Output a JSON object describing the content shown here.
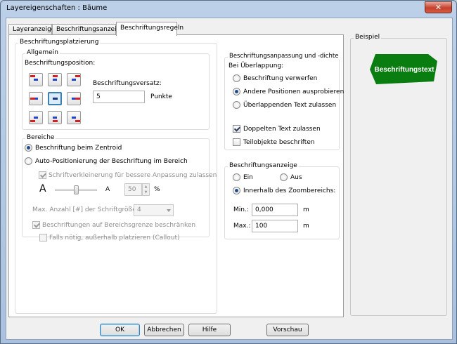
{
  "window": {
    "title": "Layereigenschaften : Bäume",
    "close_glyph": "✕"
  },
  "tabs": [
    "Layeranzeige",
    "Beschriftungsanzeige",
    "Beschriftungsregeln"
  ],
  "placement": {
    "title": "Beschriftungsplatzierung",
    "general": {
      "title": "Allgemein",
      "position_label": "Beschriftungsposition:",
      "offset_label": "Beschriftungsversatz:",
      "offset_value": "5",
      "offset_unit": "Punkte"
    },
    "areas": {
      "title": "Bereiche",
      "centroid": "Beschriftung beim Zentroid",
      "auto_position": "Auto-Positionierung der Beschriftung im Bereich",
      "font_reduce": "Schriftverkleinerung für bessere Anpassung zulassen",
      "big_a": "A",
      "small_a": "A",
      "percent_value": "50",
      "percent_unit": "%",
      "max_sizes_label": "Max. Anzahl [#] der Schriftgrößen:",
      "max_sizes_value": "4",
      "restrict": "Beschriftungen auf Bereichsgrenze beschränken",
      "callout": "Falls nötig, außerhalb platzieren (Callout)"
    }
  },
  "overlap": {
    "title": "Beschriftungsanpassung und -dichte",
    "on_overlap": "Bei Überlappung:",
    "discard": "Beschriftung verwerfen",
    "try_other": "Andere Positionen ausprobieren",
    "allow_overlap": "Überlappenden Text zulassen",
    "allow_duplicate": "Doppelten Text zulassen",
    "label_parts": "Teilobjekte beschriften"
  },
  "display": {
    "title": "Beschriftungsanzeige",
    "on": "Ein",
    "off": "Aus",
    "in_zoom": "Innerhalb des Zoombereichs:",
    "min_label": "Min.:",
    "min_value": "0,000",
    "max_label": "Max.:",
    "max_value": "100",
    "unit": "m"
  },
  "example": {
    "title": "Beispiel",
    "sample_text": "Beschriftungstext",
    "fill_color": "#0a7d10",
    "text_color": "#ffffff"
  },
  "buttons": {
    "ok": "OK",
    "cancel": "Abbrechen",
    "help": "Hilfe",
    "preview": "Vorschau"
  }
}
